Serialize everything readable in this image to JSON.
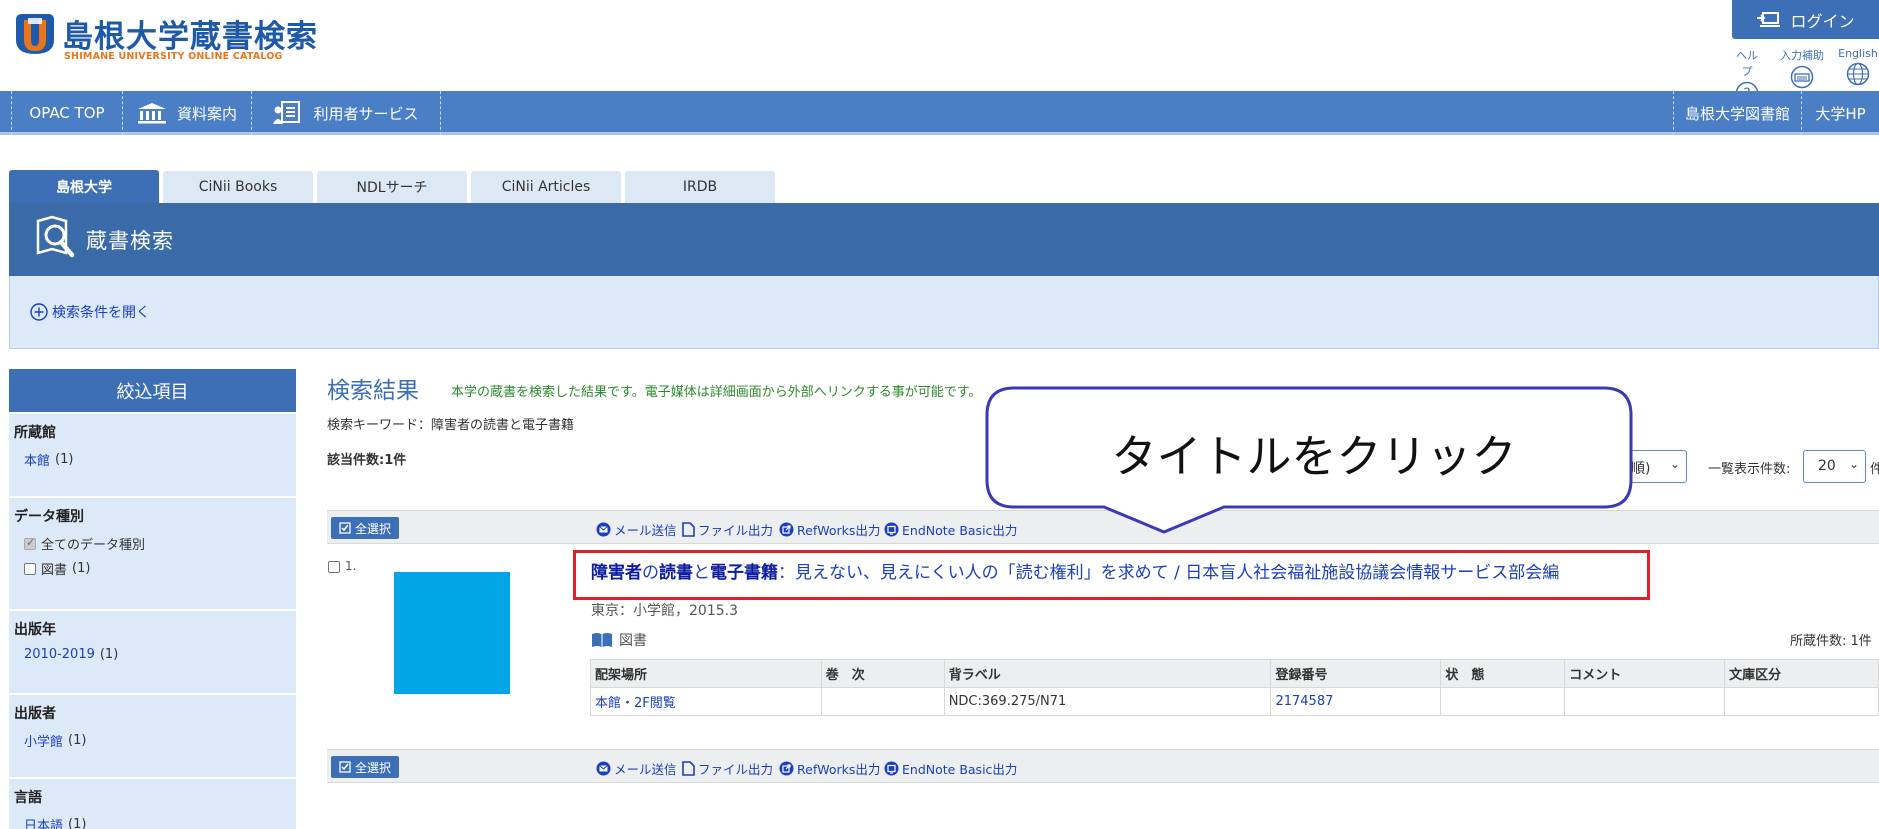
{
  "header": {
    "logo_title": "島根大学蔵書検索",
    "logo_subtitle": "SHIMANE UNIVERSITY ONLINE CATALOG",
    "login_label": "ログイン",
    "utils": [
      {
        "label": "ヘルプ",
        "icon": "help-icon"
      },
      {
        "label": "入力補助",
        "icon": "keyboard-icon"
      },
      {
        "label": "English",
        "icon": "globe-icon"
      }
    ]
  },
  "nav": {
    "left": [
      {
        "label": "OPAC TOP"
      },
      {
        "label": "資料案内",
        "icon": "library-building-icon"
      },
      {
        "label": "利用者サービス",
        "icon": "user-services-icon"
      }
    ],
    "right": [
      {
        "label": "島根大学図書館"
      },
      {
        "label": "大学HP"
      }
    ]
  },
  "tabs": [
    "島根大学",
    "CiNii Books",
    "NDLサーチ",
    "CiNii Articles",
    "IRDB"
  ],
  "banner": {
    "title": "蔵書検索"
  },
  "condition_toggle": "検索条件を開く",
  "sidebar": {
    "header": "絞込項目",
    "facets": [
      {
        "title": "所蔵館",
        "items": [
          {
            "label": "本館",
            "count": "(1)"
          }
        ]
      },
      {
        "title": "データ種別",
        "items": [
          {
            "label": "全てのデータ種別",
            "count": "",
            "checked": true
          },
          {
            "label": "図書",
            "count": "(1)",
            "checked": false
          }
        ]
      },
      {
        "title": "出版年",
        "items": [
          {
            "label": "2010-2019",
            "count": "(1)"
          }
        ]
      },
      {
        "title": "出版者",
        "items": [
          {
            "label": "小学館",
            "count": "(1)"
          }
        ]
      },
      {
        "title": "言語",
        "items": [
          {
            "label": "日本語",
            "count": "(1)"
          }
        ]
      }
    ]
  },
  "results": {
    "title": "検索結果",
    "note": "本学の蔵書を検索した結果です。電子媒体は詳細画面から外部へリンクする事が可能です。",
    "keyword": "検索キーワード：障害者の読書と電子書籍",
    "count": "該当件数:1件",
    "sort_value": "順)",
    "per_page_label": "一覧表示件数:",
    "per_page_value": "20",
    "per_page_unit": "件",
    "toolbar": {
      "select_all": "全選択",
      "actions": [
        {
          "label": "メール送信",
          "icon": "mail-icon"
        },
        {
          "label": "ファイル出力",
          "icon": "file-icon"
        },
        {
          "label": "RefWorks出力",
          "icon": "export-icon"
        },
        {
          "label": "EndNote Basic出力",
          "icon": "export-icon"
        }
      ]
    },
    "record": {
      "number": "1.",
      "title_parts": [
        {
          "text": "障害者",
          "bold": true
        },
        {
          "text": "の",
          "bold": false
        },
        {
          "text": "読書",
          "bold": true
        },
        {
          "text": "と",
          "bold": false
        },
        {
          "text": "電子書籍",
          "bold": true
        },
        {
          "text": "：見えない、見えにくい人の「読む権利」を求めて / 日本盲人社会福祉施設協議会情報サービス部会編",
          "bold": false
        }
      ],
      "publisher": "東京：小学館，2015.3",
      "type": "図書",
      "holdings_count": "所蔵件数: 1件",
      "holdings_headers": [
        "配架場所",
        "巻　次",
        "背ラベル",
        "登録番号",
        "状　態",
        "コメント",
        "文庫区分"
      ],
      "holdings_rows": [
        [
          "本館・2F閲覧",
          "",
          "NDC:369.275/N71",
          "2174587",
          "",
          "",
          ""
        ]
      ]
    }
  },
  "annotation": {
    "callout_text": "タイトルをクリック",
    "highlight_color": "#e0202a",
    "callout_border_color": "#3a3ab8"
  },
  "colors": {
    "brand": "#3d6fb6",
    "nav": "#4a7fc6",
    "panel": "#dce9f8",
    "cover": "#02a6e6",
    "link": "#1a3fbf"
  }
}
